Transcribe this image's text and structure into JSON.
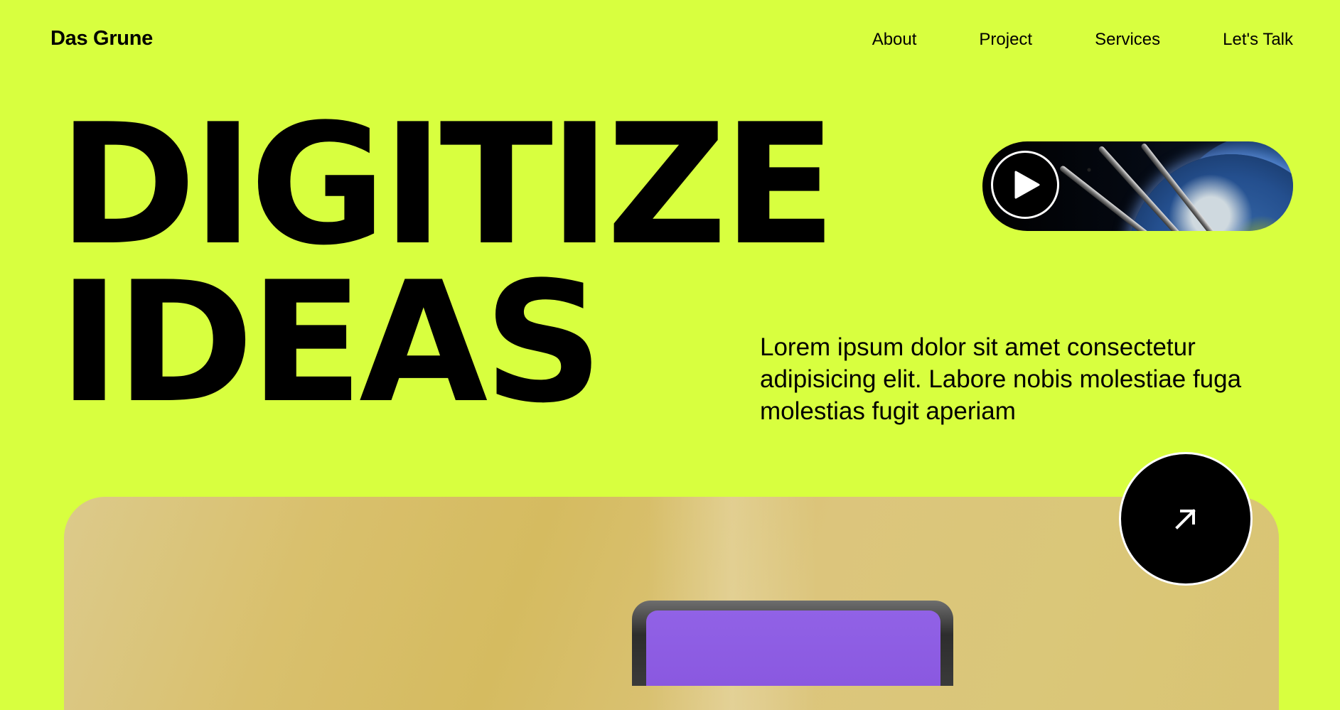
{
  "brand": {
    "name": "Das Grune"
  },
  "nav": {
    "items": [
      {
        "label": "About"
      },
      {
        "label": "Project"
      },
      {
        "label": "Services"
      },
      {
        "label": "Let's Talk"
      }
    ]
  },
  "hero": {
    "headline_line1": "DIGITIZE",
    "headline_line2": "IDEAS",
    "description": "Lorem ipsum dolor sit amet consectetur adipisicing elit. Labore nobis molestiae fuga molestias fugit aperiam"
  },
  "video": {
    "play_icon": "play-icon",
    "thumbnail": "earth-from-space"
  },
  "cta": {
    "icon": "arrow-up-right-icon"
  },
  "colors": {
    "background": "#d8ff3f",
    "text": "#000000",
    "card": "#d9c06d",
    "device_screen": "#8a58e0"
  }
}
